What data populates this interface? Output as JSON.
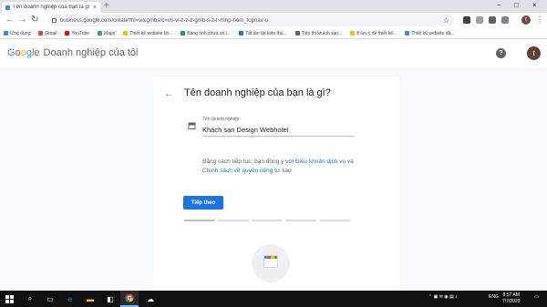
{
  "browser": {
    "tab_title": "Tên doanh nghiệp của bạn là gì?",
    "tab_close": "×",
    "new_tab": "+",
    "window_controls": {
      "minimize": "−",
      "maximize": "□",
      "close": "×"
    },
    "url": "business.google.com/create?hl=vi&gmbsrc=vn-vi-z-z-z-gmb-s-z-l~mhp-hom_topnav-u",
    "profile_initial": "t",
    "bookmarks": [
      {
        "label": "Ứng dụng",
        "color": "#4285f4"
      },
      {
        "label": "Gmail",
        "color": "#ea4335"
      },
      {
        "label": "YouTube",
        "color": "#ff0000"
      },
      {
        "label": "Maps",
        "color": "#34a853"
      },
      {
        "label": "Thiết kế website kh...",
        "color": "#fbbc04"
      },
      {
        "label": "Bảng tính chưa có t...",
        "color": "#0f9d58"
      },
      {
        "label": "Tất tần tật kiến thú...",
        "color": "#1a73e8"
      },
      {
        "label": "Tiếp thị khách sạn...",
        "color": "#5f6368"
      },
      {
        "label": "8 lưu ý để thiết kế...",
        "color": "#fbbc04"
      },
      {
        "label": "Thiết kế website dặ...",
        "color": "#4285f4"
      }
    ]
  },
  "app": {
    "logo_google": "Google",
    "logo_product": "Doanh nghiệp của tôi",
    "help_icon": "?",
    "avatar_initial": "t"
  },
  "form": {
    "back_arrow": "←",
    "heading": "Tên doanh nghiệp của bạn là gì?",
    "field_label": "Tên doanh nghiệp",
    "field_value": "Khách sạn Design Webhotel",
    "terms_prefix": "Bằng cách tiếp tục, bạn đồng ý với ",
    "terms_link1": "Điều khoản dịch vụ",
    "terms_mid": " và ",
    "terms_link2": "Chính sách về quyền riêng tư",
    "terms_suffix": " sau",
    "next_button": "Tiếp theo",
    "progress_steps": 5,
    "progress_current": 1
  },
  "taskbar": {
    "tray_language": "ENG",
    "time": "8:57 AM",
    "date": "7/7/2020"
  },
  "colors": {
    "accent": "#1a73e8",
    "taskbar": "#101010"
  }
}
